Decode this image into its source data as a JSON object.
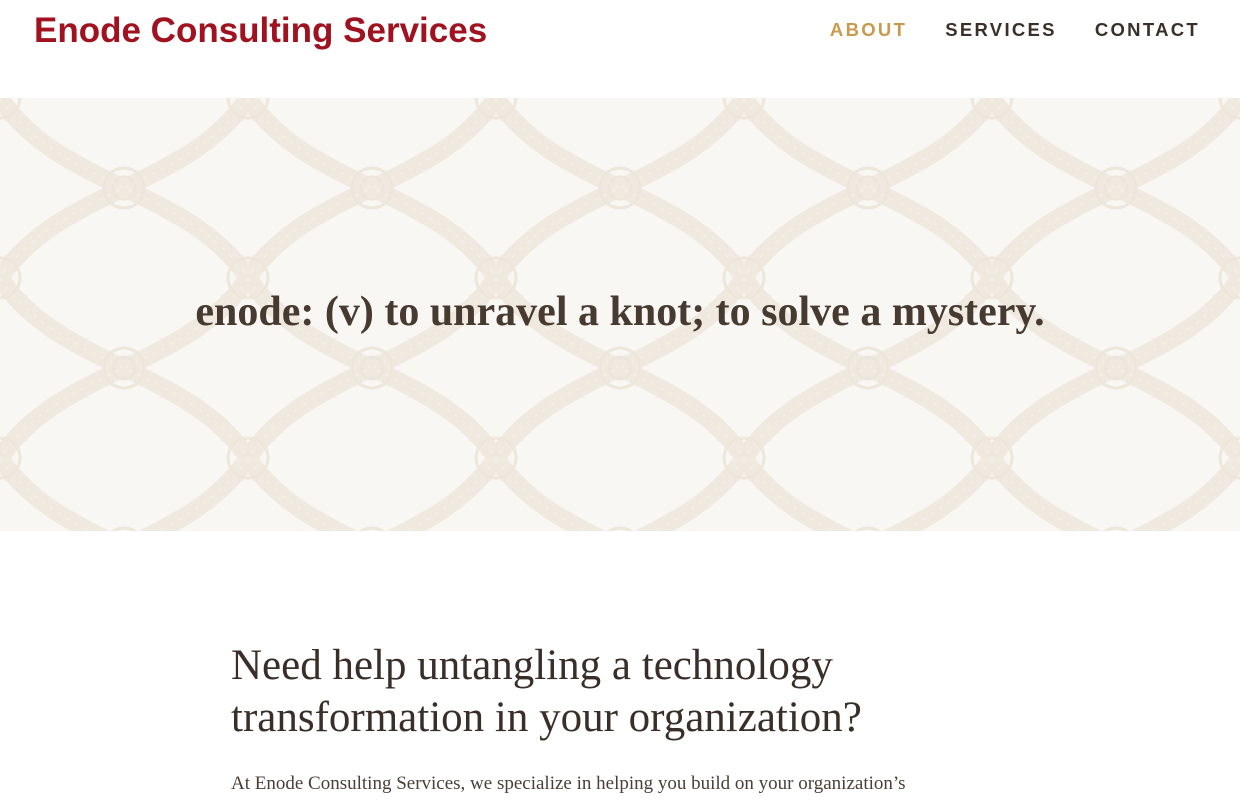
{
  "header": {
    "site_title": "Enode Consulting Services",
    "nav": [
      {
        "label": "ABOUT",
        "active": true
      },
      {
        "label": "SERVICES",
        "active": false
      },
      {
        "label": "CONTACT",
        "active": false
      }
    ]
  },
  "hero": {
    "tagline": "enode: (v) to unravel a knot; to solve a mystery.",
    "background_pattern": "rope-knot-pattern"
  },
  "main": {
    "heading": "Need help untangling a technology transformation in your organization?",
    "paragraph": "At Enode Consulting Services, we specialize in helping you build on your organization’s"
  },
  "colors": {
    "brand": "#a01220",
    "nav_active": "#c89a4e",
    "nav_text": "#3b3028",
    "hero_bg": "#f9f7f3",
    "body_text": "#3a2f28"
  }
}
